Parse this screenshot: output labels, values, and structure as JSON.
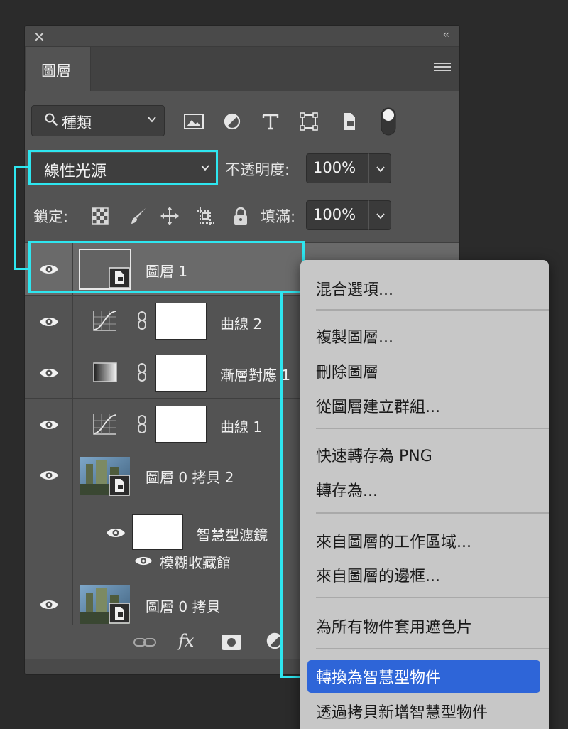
{
  "panel": {
    "close_glyph": "✕",
    "collapse_glyph": "‹‹",
    "tab_label": "圖層",
    "menu_icon": "hamburger-menu-icon"
  },
  "filter": {
    "kind_label": "種類",
    "icons": [
      "image-filter-icon",
      "adjustment-filter-icon",
      "type-filter-icon",
      "shape-filter-icon",
      "smart-object-filter-icon",
      "filter-toggle-icon"
    ]
  },
  "blend": {
    "mode": "線性光源",
    "opacity_label": "不透明度:",
    "opacity_value": "100%"
  },
  "lock": {
    "label": "鎖定:",
    "icons": [
      "lock-transparent-icon",
      "lock-pixels-icon",
      "lock-position-icon",
      "lock-artboard-icon",
      "lock-all-icon"
    ],
    "fill_label": "填滿:",
    "fill_value": "100%"
  },
  "layers": [
    {
      "name": "圖層 1",
      "type": "smart-object",
      "visible": true,
      "selected": true
    },
    {
      "name": "曲線 2",
      "type": "curves",
      "visible": true
    },
    {
      "name": "漸層對應 1",
      "type": "gradient-map",
      "visible": true
    },
    {
      "name": "曲線 1",
      "type": "curves",
      "visible": true
    },
    {
      "name": "圖層 0 拷貝 2",
      "type": "smart-object-photo",
      "visible": true
    },
    {
      "name": "智慧型濾鏡",
      "type": "smart-filter",
      "visible": true
    },
    {
      "name": "模糊收藏館",
      "type": "filter-effect",
      "visible": true
    },
    {
      "name": "圖層 0 拷貝",
      "type": "smart-object-photo",
      "visible": true
    }
  ],
  "footer_icons": [
    "link-layers-icon",
    "fx-icon",
    "add-mask-icon",
    "adjustment-layer-icon"
  ],
  "footer_fx": "fx",
  "context_menu": {
    "groups": [
      [
        "混合選項..."
      ],
      [
        "複製圖層...",
        "刪除圖層",
        "從圖層建立群組..."
      ],
      [
        "快速轉存為 PNG",
        "轉存為..."
      ],
      [
        "來自圖層的工作區域...",
        "來自圖層的邊框..."
      ],
      [
        "為所有物件套用遮色片"
      ],
      [
        "轉換為智慧型物件",
        "透過拷貝新增智慧型物件"
      ]
    ],
    "highlighted": "轉換為智慧型物件"
  },
  "colors": {
    "callout": "#2ee6f0",
    "highlight": "#2e65d8",
    "panel_bg": "#535353"
  }
}
